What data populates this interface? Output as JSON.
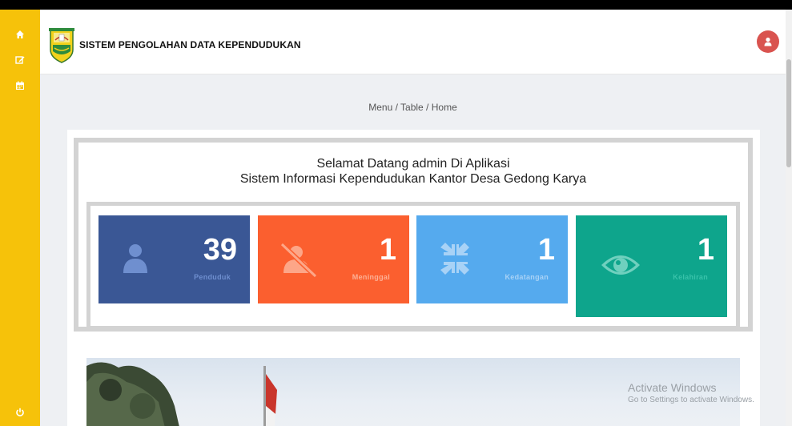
{
  "app": {
    "title": "SISTEM PENGOLAHAN DATA KEPENDUDUKAN"
  },
  "sidebar": {
    "icons": [
      "home-icon",
      "edit-icon",
      "calendar-icon"
    ],
    "bottom_icon": "power-icon",
    "color": "#f6c20a"
  },
  "breadcrumb": "Menu / Table / Home",
  "welcome": {
    "line1": "Selamat Datang admin Di Aplikasi",
    "line2": "Sistem Informasi Kependudukan Kantor Desa Gedong Karya"
  },
  "stats": [
    {
      "value": "39",
      "label": "Penduduk",
      "icon": "user-icon",
      "color": "#3a5795"
    },
    {
      "value": "1",
      "label": "Meninggal",
      "icon": "user-slash-icon",
      "color": "#fb5f2f"
    },
    {
      "value": "1",
      "label": "Kedatangan",
      "icon": "compress-arrows-icon",
      "color": "#55aaee"
    },
    {
      "value": "1",
      "label": "Kelahiran",
      "icon": "eye-icon",
      "color": "#0ea58c"
    }
  ],
  "watermark": {
    "title": "Activate Windows",
    "subtitle": "Go to Settings to activate Windows."
  }
}
